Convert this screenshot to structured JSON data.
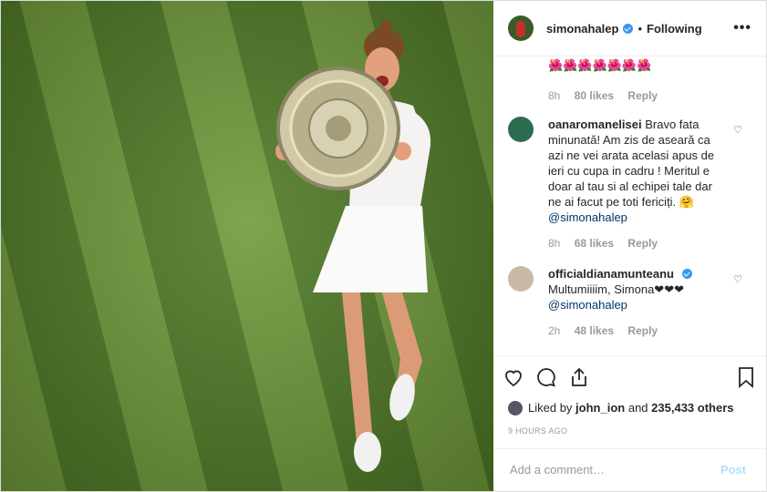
{
  "header": {
    "username": "simonahalep",
    "separator": "•",
    "follow_label": "Following",
    "more_label": "•••"
  },
  "comments": {
    "top": {
      "text": "🌺🌺🌺🌺🌺🌺🌺",
      "time": "8h",
      "likes": "80 likes",
      "reply": "Reply"
    },
    "items": [
      {
        "username": "oanaromanelisei",
        "text": "Bravo fata minunată! Am zis de aseară ca azi ne vei arata acelasi apus de ieri cu cupa in cadru ! Meritul e doar al tau si al echipei tale dar ne ai facut pe toti fericiți. 🤗",
        "mention": "@simonahalep",
        "time": "8h",
        "likes": "68 likes",
        "reply": "Reply",
        "avatar_color": "#2d6b4f"
      },
      {
        "username": "officialdianamunteanu",
        "text": "Multumiiiim, Simona❤❤❤",
        "mention": "@simonahalep",
        "time": "2h",
        "likes": "48 likes",
        "reply": "Reply",
        "avatar_color": "#c9b8a6"
      }
    ]
  },
  "actions": {
    "like_icon": "heart-icon",
    "comment_icon": "comment-icon",
    "share_icon": "share-icon",
    "save_icon": "bookmark-icon"
  },
  "liked_by": {
    "prefix": "Liked by",
    "user": "john_ion",
    "and": "and",
    "count": "235,433 others"
  },
  "timestamp": "9 HOURS AGO",
  "add_comment": {
    "placeholder": "Add a comment…",
    "post_label": "Post"
  },
  "colors": {
    "link": "#003569",
    "verified": "#3897f0",
    "post_disabled": "#b2dffc"
  }
}
